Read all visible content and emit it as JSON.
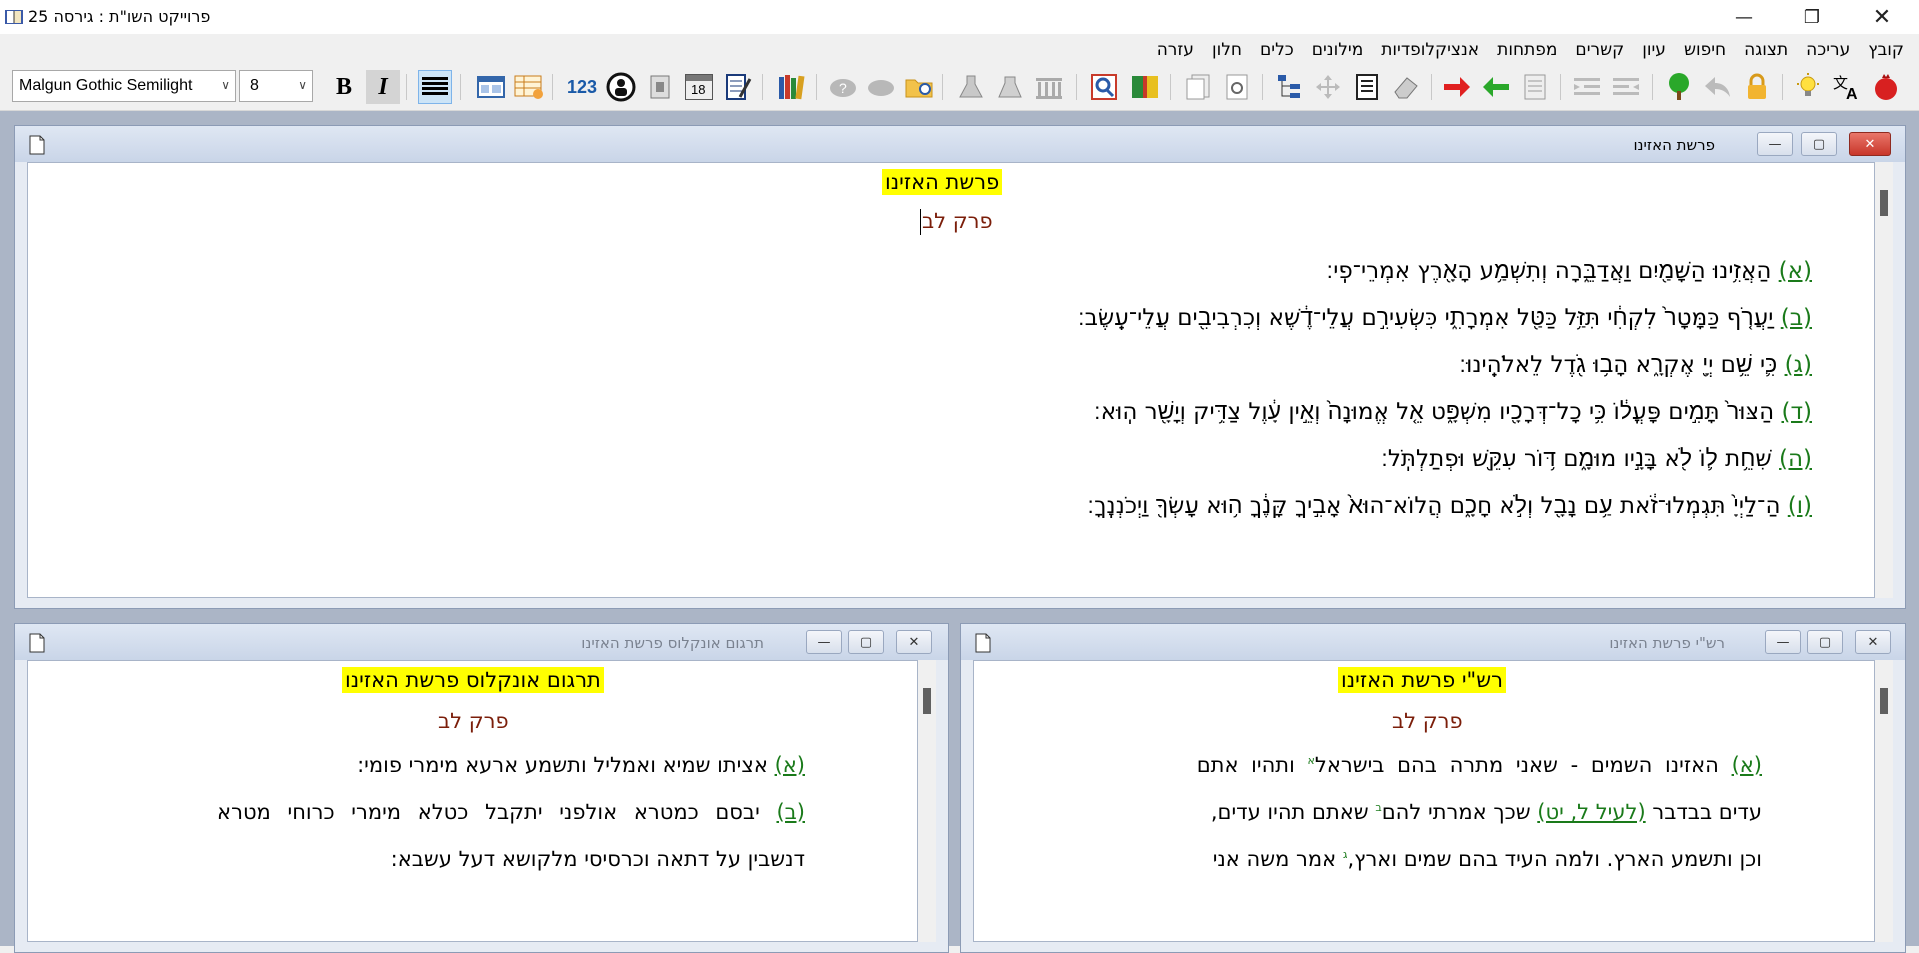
{
  "window": {
    "title": "פרוייקט השו\"ת  :  גירסה 25"
  },
  "menu": [
    "קובץ",
    "עריכה",
    "תצוגה",
    "חיפוש",
    "עיון",
    "קשרים",
    "מפתחות",
    "אנציקלופדיות",
    "מילונים",
    "כלים",
    "חלון",
    "עזרה"
  ],
  "toolbar": {
    "font_name": "Malgun Gothic Semilight",
    "font_size": "8",
    "bold": "B",
    "italic": "I",
    "number_icon_label": "123",
    "calendar_day": "18"
  },
  "main_pane": {
    "title": "פרשת האזינו",
    "heading": "פרשת האזינו",
    "chapter": "פרק לב",
    "verses": [
      {
        "num": "(א)",
        "text": "הַאֲזִ֥ינוּ הַשָּׁמַ֖יִם וַאֲדַבֵּ֑רָה וְתִשְׁמַ֥ע הָאָ֖רֶץ אִמְרֵי־פִֽי׃"
      },
      {
        "num": "(ב)",
        "text": "יַעֲרֹ֤ף כַּמָּטָר֙ לִקְחִ֔י תִּזַּ֥ל כַּטַּ֖ל אִמְרָתִ֑י כִּשְׂעִירִ֣ם עֲלֵי־דֶ֔שֶׁא וְכִרְבִיבִ֖ים עֲלֵי־עֵֽשֶׂב׃"
      },
      {
        "num": "(ג)",
        "text": "כִּ֛י שֵׁ֥ם יְיָ֖ אֶקְרָ֑א הָב֥וּ גֹ֖דֶל לֵאלֹהֵֽינוּ׃"
      },
      {
        "num": "(ד)",
        "text": "הַצּוּר֙ תָּמִ֣ים פָּעֳל֔וֹ כִּ֥י כָל־דְּרָכָ֖יו מִשְׁפָּ֑ט אֵ֤ל אֱמוּנָה֙ וְאֵ֣ין עָ֔וֶל צַדִּ֥יק וְיָשָׁ֖ר הֽוּא׃"
      },
      {
        "num": "(ה)",
        "text": "שִׁחֵ֥ת ל֛וֹ לֹ֖א בָּנָ֣יו מוּמָ֑ם דּ֥וֹר עִקֵּ֖שׁ וּפְתַלְתֹּֽל׃"
      },
      {
        "num": "(ו)",
        "text": "הַ־לַיְיָ֙ תִּגְמְלוּ־זֹ֔את עַ֥ם נָבָ֖ל וְלֹ֣א חָכָ֑ם הֲלוֹא־הוּא֙ אָבִ֣יךָ קָּנֶ֔ךָ ה֥וּא עָשְׂךָ֖ וַיְכֹנְנֶֽךָ׃"
      }
    ]
  },
  "onkelos_pane": {
    "title": "תרגום אונקלוס פרשת האזינו",
    "heading": "תרגום אונקלוס פרשת האזינו",
    "chapter": "פרק לב",
    "lines": [
      {
        "num": "(א)",
        "text": "אציתו שמיא ואמליל ותשמע ארעא מימרי פומי:"
      },
      {
        "num": "(ב)",
        "text": "יבסם כמטרא אולפני יתקבל כטלא מימרי כרוחי מטרא"
      },
      {
        "num": "",
        "text": "דנשבין על דתאה וכרסיסי מלקושא דעל עשבא:"
      }
    ]
  },
  "rashi_pane": {
    "title": "רש\"י פרשת האזינו",
    "heading": "רש\"י פרשת האזינו",
    "chapter": "פרק לב",
    "line1": {
      "num": "(א)",
      "text": "האזינו השמים - שאני מתרה בהם בישראל",
      "note": "א",
      "rest": "ותהיו אתם"
    },
    "line2": {
      "a": "עדים בבדבר",
      "ref": "(לעיל ל, יט)",
      "b": "שכך אמרתי להם",
      "note": "ב",
      "c": "שאתם תהיו עדים,"
    },
    "line3": {
      "a": "וכן ותשמע הארץ. ולמה העיד בהם שמים וארץ,",
      "note": "ג",
      "b": "אמר משה אני"
    }
  }
}
